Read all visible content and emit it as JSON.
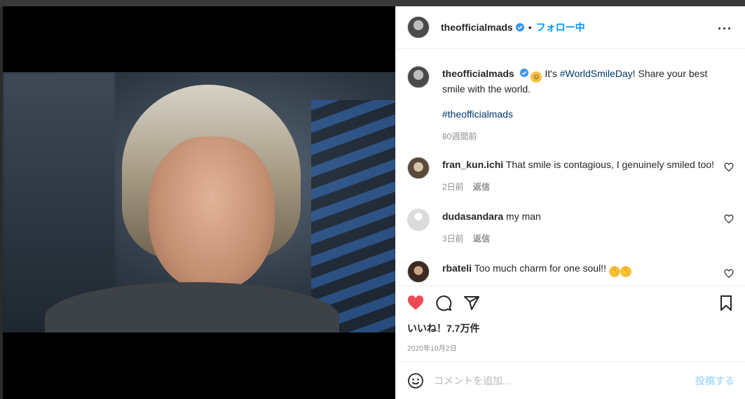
{
  "post": {
    "username": "theofficialmads",
    "follow_label": "フォロー中",
    "caption_text": " It's ",
    "caption_tag": "#WorldSmileDay",
    "caption_rest": "! Share your best smile with the world.",
    "caption_hashtag": "#theofficialmads",
    "caption_time": "80週間前"
  },
  "comments": [
    {
      "user": "fran_kun.ichi",
      "text": "That smile is contagious, I genuinely smiled too!",
      "time": "2日前",
      "reply": "返信"
    },
    {
      "user": "dudasandara",
      "text": "my man",
      "time": "3日前",
      "reply": "返信"
    },
    {
      "user": "rbateli",
      "text": "Too much charm for one soul!!"
    }
  ],
  "actions": {
    "likes": "いいね！7.7万件",
    "date": "2020年10月2日"
  },
  "composer": {
    "placeholder": "コメントを追加...",
    "post_label": "投稿する"
  },
  "colors": {
    "accent": "#0095f6",
    "like": "#ed4956",
    "link": "#00376b"
  }
}
